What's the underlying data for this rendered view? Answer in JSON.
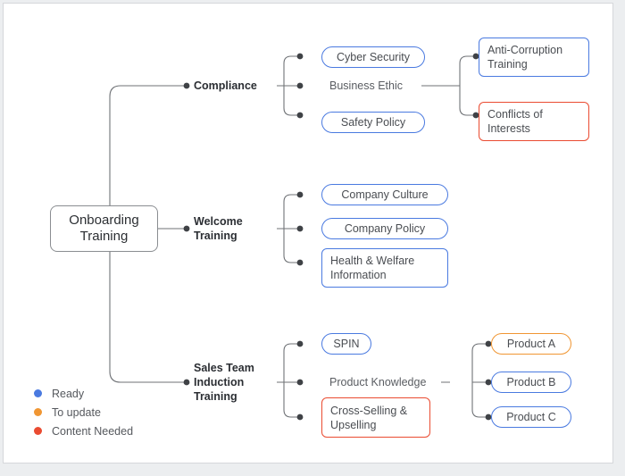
{
  "legend": {
    "items": [
      {
        "label": "Ready",
        "color": "#4a7ae0"
      },
      {
        "label": "To update",
        "color": "#f09633"
      },
      {
        "label": "Content Needed",
        "color": "#ea4b31"
      }
    ]
  },
  "mindmap": {
    "root": {
      "label": "Onboarding Training",
      "line1": "Onboarding",
      "line2": "Training"
    },
    "branches": [
      {
        "label": "Compliance",
        "children": [
          {
            "label": "Cyber Security",
            "status": "#4a7ae0"
          },
          {
            "label": "Business Ethic",
            "status": "none",
            "children": [
              {
                "label": "Anti-Corruption Training",
                "line1": "Anti-Corruption",
                "line2": "Training",
                "status": "#4a7ae0"
              },
              {
                "label": "Conflicts of Interests",
                "line1": "Conflicts of",
                "line2": "Interests",
                "status": "#ea4b31"
              }
            ]
          },
          {
            "label": "Safety Policy",
            "status": "#4a7ae0"
          }
        ]
      },
      {
        "label": "Welcome Training",
        "line1": "Welcome",
        "line2": "Training",
        "children": [
          {
            "label": "Company Culture",
            "status": "#4a7ae0"
          },
          {
            "label": "Company Policy",
            "status": "#4a7ae0"
          },
          {
            "label": "Health & Welfare Information",
            "line1": "Health & Welfare",
            "line2": "Information",
            "status": "#4a7ae0"
          }
        ]
      },
      {
        "label": "Sales Team Induction Training",
        "line1": "Sales Team",
        "line2": "Induction",
        "line3": "Training",
        "children": [
          {
            "label": "SPIN",
            "status": "#4a7ae0"
          },
          {
            "label": "Product Knowledge",
            "status": "none",
            "children": [
              {
                "label": "Product A",
                "status": "#f09633"
              },
              {
                "label": "Product B",
                "status": "#4a7ae0"
              },
              {
                "label": "Product C",
                "status": "#4a7ae0"
              }
            ]
          },
          {
            "label": "Cross-Selling & Upselling",
            "line1": "Cross-Selling &",
            "line2": "Upselling",
            "status": "#ea4b31"
          }
        ]
      }
    ]
  }
}
